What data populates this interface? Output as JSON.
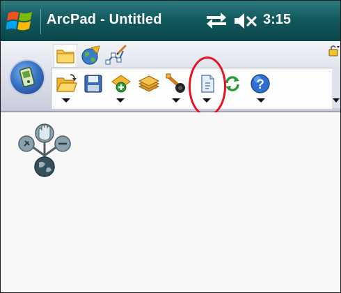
{
  "window": {
    "title": "ArcPad - Untitled",
    "clock": "3:15"
  },
  "icons": {
    "start": "windows-flag-icon",
    "sync": "sync-arrows-icon",
    "mute": "speaker-muted-icon",
    "gps_orb": "gps-device-icon",
    "menu": "menu-lock-icon"
  },
  "toolbar": {
    "tabs": [
      {
        "name": "browse-tab",
        "icon": "folder-icon",
        "active": true
      },
      {
        "name": "map-tab",
        "icon": "globe-icon",
        "active": false
      },
      {
        "name": "edit-tab",
        "icon": "edit-vertices-icon",
        "active": false
      }
    ],
    "tools": [
      {
        "name": "open-button",
        "icon": "open-folder-icon",
        "has_dropdown": true
      },
      {
        "name": "save-button",
        "icon": "floppy-icon",
        "has_dropdown": false
      },
      {
        "name": "add-layer-button",
        "icon": "add-layer-icon",
        "has_dropdown": true
      },
      {
        "name": "layers-button",
        "icon": "layers-icon",
        "has_dropdown": false
      },
      {
        "name": "gps-tools-button",
        "icon": "gps-tools-icon",
        "has_dropdown": true
      },
      {
        "name": "document-button",
        "icon": "document-icon",
        "has_dropdown": true
      },
      {
        "name": "refresh-button",
        "icon": "refresh-icon",
        "has_dropdown": false
      },
      {
        "name": "help-button",
        "icon": "help-icon",
        "has_dropdown": true
      }
    ],
    "highlighted_tool": "document-button",
    "highlight_color": "#e8111d"
  },
  "map": {
    "navigator_icon": "pan-zoom-navigator-icon"
  },
  "colors": {
    "titlebar": "#125a5e",
    "toolbar": "#dfe2ec",
    "accent": "#3a74c8"
  }
}
